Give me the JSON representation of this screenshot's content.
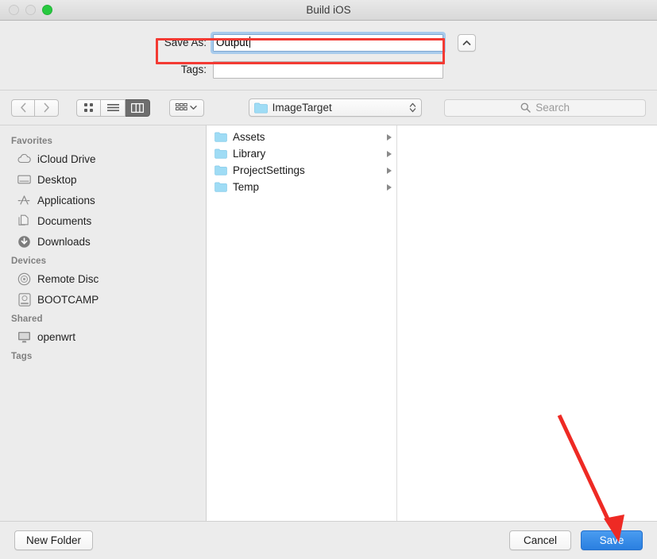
{
  "window": {
    "title": "Build iOS",
    "traffic_lights": [
      "close-button",
      "minimize-button",
      "zoom-button"
    ]
  },
  "form": {
    "save_as_label": "Save As:",
    "save_as_value": "Output",
    "tags_label": "Tags:",
    "tags_value": "",
    "collapse_icon": "chevron-up-icon"
  },
  "toolbar": {
    "back_icon": "chevron-left-icon",
    "forward_icon": "chevron-right-icon",
    "view_icon_label": "icon-view",
    "view_list_label": "list-view",
    "view_column_label": "column-view",
    "active_view": "column-view",
    "arrange_label": "arrange-by",
    "arrange_chevron": "chevron-down-icon",
    "location": "ImageTarget",
    "location_icon": "folder-icon",
    "location_stepper": "up-down-stepper-icon",
    "search_placeholder": "Search",
    "search_icon": "search-icon"
  },
  "sidebar": {
    "sections": [
      {
        "title": "Favorites",
        "items": [
          {
            "label": "iCloud Drive",
            "icon": "icloud-icon"
          },
          {
            "label": "Desktop",
            "icon": "desktop-icon"
          },
          {
            "label": "Applications",
            "icon": "applications-icon"
          },
          {
            "label": "Documents",
            "icon": "documents-icon"
          },
          {
            "label": "Downloads",
            "icon": "downloads-icon"
          }
        ]
      },
      {
        "title": "Devices",
        "items": [
          {
            "label": "Remote Disc",
            "icon": "disc-icon"
          },
          {
            "label": "BOOTCAMP",
            "icon": "harddisk-icon"
          }
        ]
      },
      {
        "title": "Shared",
        "items": [
          {
            "label": "openwrt",
            "icon": "display-icon"
          }
        ]
      },
      {
        "title": "Tags",
        "items": []
      }
    ]
  },
  "filebrowser": {
    "rows": [
      {
        "name": "Assets",
        "icon": "folder-icon",
        "disclosure": "disclosure-triangle"
      },
      {
        "name": "Library",
        "icon": "folder-icon",
        "disclosure": "disclosure-triangle"
      },
      {
        "name": "ProjectSettings",
        "icon": "folder-icon",
        "disclosure": "disclosure-triangle"
      },
      {
        "name": "Temp",
        "icon": "folder-icon",
        "disclosure": "disclosure-triangle"
      }
    ]
  },
  "footer": {
    "new_folder_label": "New Folder",
    "cancel_label": "Cancel",
    "save_label": "Save"
  },
  "annotations": {
    "highlight_color": "#f33a33",
    "arrow_color": "#ee2a24"
  }
}
